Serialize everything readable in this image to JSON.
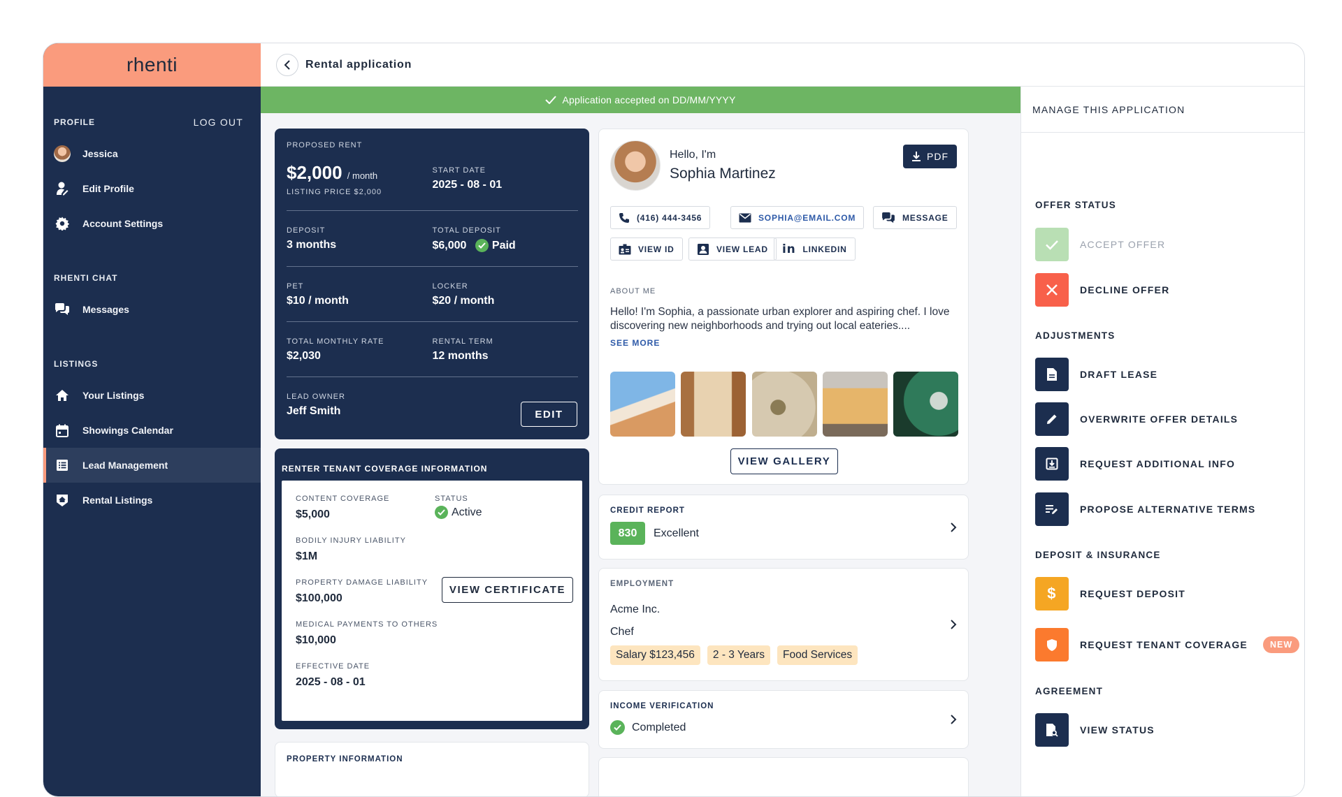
{
  "brand": {
    "logo": "rhenti"
  },
  "sidebar": {
    "profile_heading": "PROFILE",
    "logout": "LOG OUT",
    "user_name": "Jessica",
    "edit_profile": "Edit Profile",
    "account_settings": "Account Settings",
    "chat_heading": "RHENTI CHAT",
    "messages": "Messages",
    "listings_heading": "LISTINGS",
    "your_listings": "Your Listings",
    "showings_calendar": "Showings Calendar",
    "lead_management": "Lead Management",
    "rental_listings": "Rental Listings"
  },
  "topbar": {
    "title": "Rental application"
  },
  "banner": {
    "text": "Application accepted on DD/MM/YYYY"
  },
  "rent": {
    "heading": "PROPOSED RENT",
    "amount": "$2,000",
    "per": "/ month",
    "listing_price": "LISTING PRICE $2,000",
    "start_label": "START DATE",
    "start_value": "2025 - 08 - 01",
    "deposit_label": "DEPOSIT",
    "deposit_value": "3 months",
    "total_deposit_label": "TOTAL DEPOSIT",
    "total_deposit_value": "$6,000",
    "paid": "Paid",
    "pet_label": "PET",
    "pet_value": "$10 / month",
    "locker_label": "LOCKER",
    "locker_value": "$20 / month",
    "monthly_label": "TOTAL MONTHLY RATE",
    "monthly_value": "$2,030",
    "term_label": "RENTAL TERM",
    "term_value": "12 months",
    "owner_label": "LEAD OWNER",
    "owner_value": "Jeff Smith",
    "edit": "EDIT"
  },
  "coverage": {
    "heading": "RENTER TENANT COVERAGE INFORMATION",
    "content_label": "CONTENT COVERAGE",
    "content_value": "$5,000",
    "status_label": "STATUS",
    "status_value": "Active",
    "bodily_label": "BODILY INJURY LIABILITY",
    "bodily_value": "$1M",
    "view_certificate": "VIEW CERTIFICATE",
    "property_label": "PROPERTY DAMAGE LIABILITY",
    "property_value": "$100,000",
    "medical_label": "MEDICAL PAYMENTS TO OTHERS",
    "medical_value": "$10,000",
    "effective_label": "EFFECTIVE DATE",
    "effective_value": "2025 - 08 - 01"
  },
  "property": {
    "heading": "PROPERTY INFORMATION"
  },
  "profile": {
    "hello": "Hello, I'm",
    "name": "Sophia Martinez",
    "pdf": "PDF",
    "phone": "(416) 444-3456",
    "email": "SOPHIA@EMAIL.COM",
    "message": "MESSAGE",
    "view_id": "VIEW ID",
    "view_lead": "VIEW LEAD",
    "linkedin": "LINKEDIN",
    "about_label": "ABOUT ME",
    "about_text": "Hello! I'm Sophia, a passionate urban explorer and aspiring chef. I love discovering new neighborhoods and trying out local eateries....",
    "see_more": "SEE MORE",
    "view_gallery": "VIEW GALLERY"
  },
  "credit": {
    "label": "CREDIT REPORT",
    "score": "830",
    "rating": "Excellent"
  },
  "employment": {
    "label": "EMPLOYMENT",
    "company": "Acme Inc.",
    "role": "Chef",
    "tags": [
      "Salary $123,456",
      "2 - 3 Years",
      "Food Services"
    ]
  },
  "income": {
    "label": "INCOME VERIFICATION",
    "status": "Completed"
  },
  "manage": {
    "heading": "MANAGE THIS APPLICATION",
    "offer_status": "OFFER STATUS",
    "accept": "ACCEPT OFFER",
    "decline": "DECLINE OFFER",
    "adjustments": "ADJUSTMENTS",
    "draft_lease": "DRAFT LEASE",
    "overwrite": "OVERWRITE OFFER DETAILS",
    "request_info": "REQUEST ADDITIONAL INFO",
    "propose": "PROPOSE ALTERNATIVE TERMS",
    "deposit_insurance": "DEPOSIT & INSURANCE",
    "request_deposit": "REQUEST DEPOSIT",
    "request_coverage": "REQUEST TENANT COVERAGE",
    "new_badge": "NEW",
    "agreement": "AGREEMENT",
    "view_status": "VIEW STATUS"
  },
  "colors": {
    "navy": "#1c2e4f",
    "coral": "#fa9b7d",
    "green": "#6db563",
    "amber": "#f5a623",
    "orange": "#fb7a2e",
    "red": "#f8604a",
    "mint": "#b9dfb4"
  }
}
